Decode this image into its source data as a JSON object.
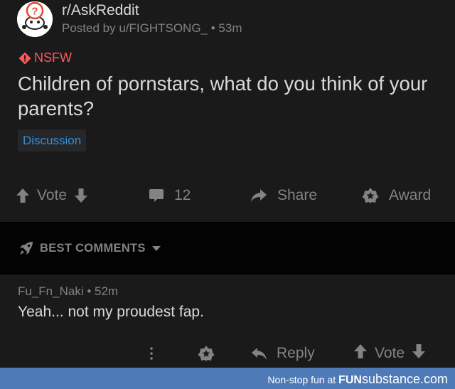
{
  "post": {
    "subreddit": "r/AskReddit",
    "byline": "Posted by u/FIGHTSONG_ • 53m",
    "nsfw_label": "NSFW",
    "title": "Children of pornstars, what do you think of your parents?",
    "flair": "Discussion"
  },
  "actions": {
    "vote_label": "Vote",
    "comments_count": "12",
    "share_label": "Share",
    "award_label": "Award"
  },
  "sort": {
    "label": "BEST COMMENTS"
  },
  "comment": {
    "meta": "Fu_Fn_Naki • 52m",
    "body": "Yeah... not my proudest fap.",
    "reply_label": "Reply",
    "vote_label": "Vote"
  },
  "footer": {
    "tagline": "Non-stop fun at",
    "brand_bold": "FUN",
    "brand_light": "substance.com"
  },
  "colors": {
    "background": "#1a1a1b",
    "sort_bar": "#030303",
    "nsfw": "#ff585b",
    "flair_text": "#2f8fd6",
    "muted": "#818384",
    "footer": "#4f7ab8"
  }
}
